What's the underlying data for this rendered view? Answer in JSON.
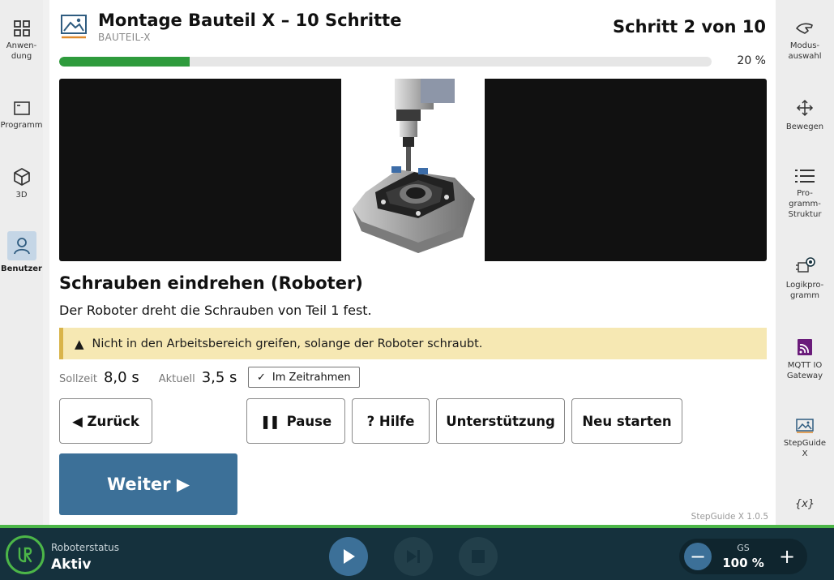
{
  "left_nav": [
    {
      "label": "Anwen-\ndung",
      "icon": "grid-icon"
    },
    {
      "label": "Programm",
      "icon": "program-icon"
    },
    {
      "label": "3D",
      "icon": "cube-icon"
    },
    {
      "label": "Benutzer",
      "icon": "user-icon",
      "active": true
    }
  ],
  "right_nav": [
    {
      "label": "Modus-\nauswahl",
      "icon": "hand-icon"
    },
    {
      "label": "Bewegen",
      "icon": "move-icon"
    },
    {
      "label": "Pro-\ngramm-\nStruktur",
      "icon": "list-icon"
    },
    {
      "label": "Logikpro-\ngramm",
      "icon": "logic-icon"
    },
    {
      "label": "MQTT IO\nGateway",
      "icon": "mqtt-icon"
    },
    {
      "label": "StepGuide\nX",
      "icon": "image-icon"
    },
    {
      "label": "{x}",
      "icon": "variables-icon"
    }
  ],
  "header": {
    "title": "Montage Bauteil X – 10 Schritte",
    "subtitle": "BAUTEIL-X",
    "step_counter": "Schritt 2 von 10",
    "progress_percent": 20,
    "progress_text": "20 %"
  },
  "step": {
    "title": "Schrauben eindrehen (Roboter)",
    "description": "Der Roboter dreht die Schrauben von Teil 1 fest.",
    "warning": "Nicht in den Arbeitsbereich greifen, solange der Roboter schraubt.",
    "soll_label": "Sollzeit",
    "soll_value": "8,0 s",
    "ist_label": "Aktuell",
    "ist_value": "3,5 s",
    "timing_badge": "Im Zeitrahmen"
  },
  "buttons": {
    "back": "◀ Zurück",
    "pause": "Pause",
    "help": "? Hilfe",
    "support": "Unterstützung",
    "restart": "Neu starten",
    "next": "Weiter ▶"
  },
  "version": "StepGuide X 1.0.5",
  "bottom_bar": {
    "status_label": "Roboterstatus",
    "status_value": "Aktiv",
    "speed_label": "GS",
    "speed_value": "100 %"
  },
  "colors": {
    "progress": "#2e9b3c",
    "primary": "#3c7098",
    "warning_bg": "#f6e8b3",
    "bar_bg": "#15313d",
    "accent_green": "#4cb648"
  }
}
